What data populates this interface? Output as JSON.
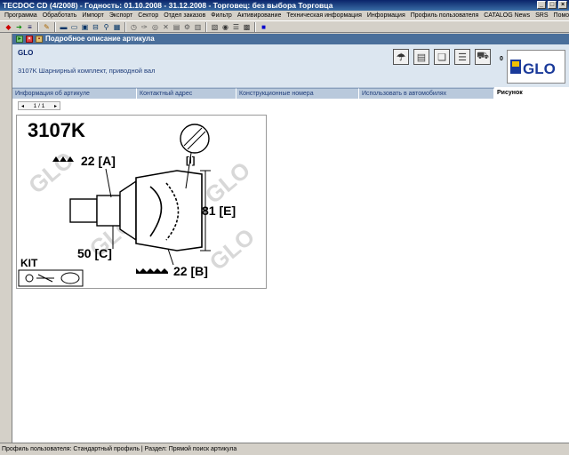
{
  "window": {
    "title": "TECDOC CD (4/2008)  -  Годность: 01.10.2008 - 31.12.2008  -  Торговец: без выбора Торговца",
    "btn_min": "_",
    "btn_max": "□",
    "btn_close": "×"
  },
  "menu": [
    "Программа",
    "Обработать",
    "Импорт",
    "Экспорт",
    "Сектор",
    "Отдел заказов",
    "Фильтр",
    "Активирование",
    "Техническая информация",
    "Информация",
    "Профиль пользователя",
    "CATALOG News",
    "SRS",
    "Помощь"
  ],
  "panel": {
    "title": "Подробное описание артикула"
  },
  "article": {
    "supplier": "GLO",
    "description": "3107K Шарнирный комплект, приводной вал",
    "counter": "0"
  },
  "tabs": [
    "Информация об артикуле",
    "Контактный адрес",
    "Конструкционные номера",
    "Использовать в автомобилях",
    "Рисунок"
  ],
  "pager": {
    "text": "1  /  1"
  },
  "drawing": {
    "part_number": "3107K",
    "dim_a": "22 [A]",
    "dim_b": "22 [B]",
    "dim_c": "50 [C]",
    "dim_e": "81 [E]",
    "dim_i": "[I]",
    "kit": "KIT",
    "watermark": "GLO"
  },
  "logo": {
    "text": "GLO"
  },
  "status": {
    "text": "Профиль пользователя: Стандартный профиль | Раздел: Прямой поиск артикула"
  },
  "colors": {
    "accent": "#4a6f9b",
    "title_bar": "#0a246a",
    "info_bg": "#dce6f0"
  }
}
